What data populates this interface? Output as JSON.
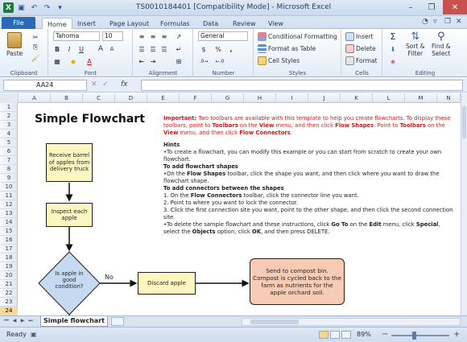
{
  "window": {
    "title": "TS0010184401  [Compatibility Mode]  -  Microsoft Excel"
  },
  "tabs": {
    "file": "File",
    "items": [
      "Home",
      "Insert",
      "Page Layout",
      "Formulas",
      "Data",
      "Review",
      "View"
    ]
  },
  "ribbon": {
    "clipboard": {
      "paste": "Paste",
      "label": "Clipboard"
    },
    "font": {
      "name": "Tahoma",
      "size": "10",
      "bold": "B",
      "italic": "I",
      "underline": "U",
      "grow": "A",
      "shrink": "A",
      "label": "Font"
    },
    "alignment": {
      "label": "Alignment"
    },
    "number": {
      "format": "General",
      "currency": "$",
      "percent": "%",
      "comma": ",",
      "label": "Number"
    },
    "styles": {
      "conditional": "Conditional Formatting",
      "table": "Format as Table",
      "cell": "Cell Styles",
      "label": "Styles"
    },
    "cells": {
      "insert": "Insert",
      "delete": "Delete",
      "format": "Format",
      "label": "Cells"
    },
    "editing": {
      "sum": "Σ",
      "sort": "Sort &",
      "sort2": "Filter",
      "find": "Find &",
      "find2": "Select",
      "label": "Editing"
    }
  },
  "formula_bar": {
    "name_box": "AA24",
    "fx": "fx",
    "value": ""
  },
  "columns": [
    "A",
    "B",
    "C",
    "D",
    "E",
    "F",
    "G",
    "H",
    "I",
    "J",
    "K",
    "L",
    "M",
    "N"
  ],
  "rows": [
    "1",
    "2",
    "3",
    "4",
    "5",
    "6",
    "7",
    "8",
    "9",
    "10",
    "11",
    "12",
    "13",
    "14",
    "15",
    "16",
    "17",
    "18",
    "19",
    "20",
    "21",
    "22",
    "23",
    "24"
  ],
  "selected_row": "24",
  "sheet": {
    "title": "Simple Flowchart",
    "boxes": {
      "receive": "Receive barrel of apples from delivery truck",
      "inspect": "Inspect each apple",
      "decision": "Is apple in good condition?",
      "discard": "Discard apple",
      "compost": "Send to compost bin. Compost is cycled back to the farm as nutrients for the apple orchard soil.",
      "no_label": "No"
    },
    "notes": {
      "important_label": "Important:",
      "important_1": " Two toolbars are available with this template to help you create flowcharts. To display these toolbars, point to ",
      "toolbars": "Toolbars",
      "on_the": " on the ",
      "view": "View",
      "menu_click": " menu, and then click ",
      "flow_shapes": "Flow Shapes",
      "point_to": ". Point to ",
      "flow_connectors": "Flow Connectors",
      "period": ".",
      "hints": "Hints",
      "hint_1": "•To create a flowchart, you can modify this example or you can start from scratch to create your own flowchart.",
      "add_shapes_h": "To add flowchart shapes",
      "add_shapes_1": "•On the ",
      "add_shapes_2": " toolbar, click the shape you want, and then click where you want to draw the flowchart shape.",
      "add_conn_h": "To add connectors between the shapes",
      "conn_1a": "1. On the ",
      "conn_1b": " toolbar, click the connector line you want.",
      "conn_2": "2. Point to where you want to lock the connector.",
      "conn_3": "3. Click the first connection site you want, point to the other shape, and then click  the second connection site.",
      "del_1": "•To delete the sample flowchart and these instructions, click ",
      "goto": "Go To",
      "del_2": " on the ",
      "edit": "Edit",
      "del_3": " menu, click ",
      "special": "Special",
      "del_4": ", select the ",
      "objects": "Objects",
      "del_5": " option, click ",
      "ok": "OK",
      "del_6": ", and then press DELETE."
    }
  },
  "sheet_tab": "Simple flowchart",
  "status": {
    "text": "Ready",
    "zoom": "89%",
    "minus": "−",
    "plus": "+"
  },
  "colors": {
    "accent": "#2a69b8",
    "flow_box": "#fef6c0",
    "decision": "#c5daf1",
    "compost": "#f8cbb5",
    "important": "#d21818"
  }
}
